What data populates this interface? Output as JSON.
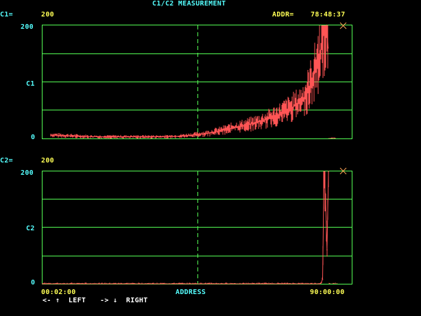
{
  "title": "C1/C2 MEASUREMENT",
  "colors": {
    "background": "#000000",
    "grid": "#55ff55",
    "trace": "#ff5555",
    "label": "#55ffff",
    "value": "#ffff55",
    "marker": "#ffaa55"
  },
  "header": {
    "c1_label": "C1=",
    "c1_value": "200",
    "addr_label": "ADDR=",
    "addr_value": "78:48:37"
  },
  "plot1": {
    "y_top": "200",
    "y_mid": "C1",
    "y_bottom": "0"
  },
  "plot2": {
    "header_label": "C2=",
    "header_value": "200",
    "y_top": "200",
    "y_mid": "C2",
    "y_bottom": "0"
  },
  "x_axis": {
    "start": "00:02:00",
    "center": "ADDRESS",
    "end": "90:00:00"
  },
  "footer": {
    "left_hint": "<- ↑  LEFT",
    "right_hint": "-> ↓  RIGHT"
  },
  "chart_data": [
    {
      "type": "line",
      "series": [
        {
          "x": [
            0.0,
            0.05,
            0.1,
            0.15,
            0.2,
            0.25,
            0.3,
            0.35,
            0.4,
            0.45,
            0.5,
            0.55,
            0.6,
            0.65,
            0.7,
            0.75,
            0.8,
            0.85,
            0.88,
            0.9,
            0.92,
            0.93,
            0.94,
            0.95,
            0.96,
            0.97,
            0.975
          ],
          "values": [
            6,
            5,
            4,
            3,
            3,
            3,
            3,
            3,
            3,
            4,
            6,
            9,
            14,
            20,
            25,
            32,
            42,
            55,
            65,
            80,
            105,
            120,
            140,
            160,
            190,
            200,
            160
          ]
        }
      ],
      "ylim": [
        0,
        200
      ],
      "grid": true
    },
    {
      "type": "line",
      "series": [
        {
          "x": [
            0.0,
            0.9,
            0.94,
            0.945,
            0.95,
            0.955,
            0.96,
            0.965,
            0.97
          ],
          "values": [
            0,
            0,
            0,
            2,
            8,
            200,
            150,
            60,
            200
          ]
        }
      ],
      "ylim": [
        0,
        200
      ],
      "grid": true
    }
  ]
}
